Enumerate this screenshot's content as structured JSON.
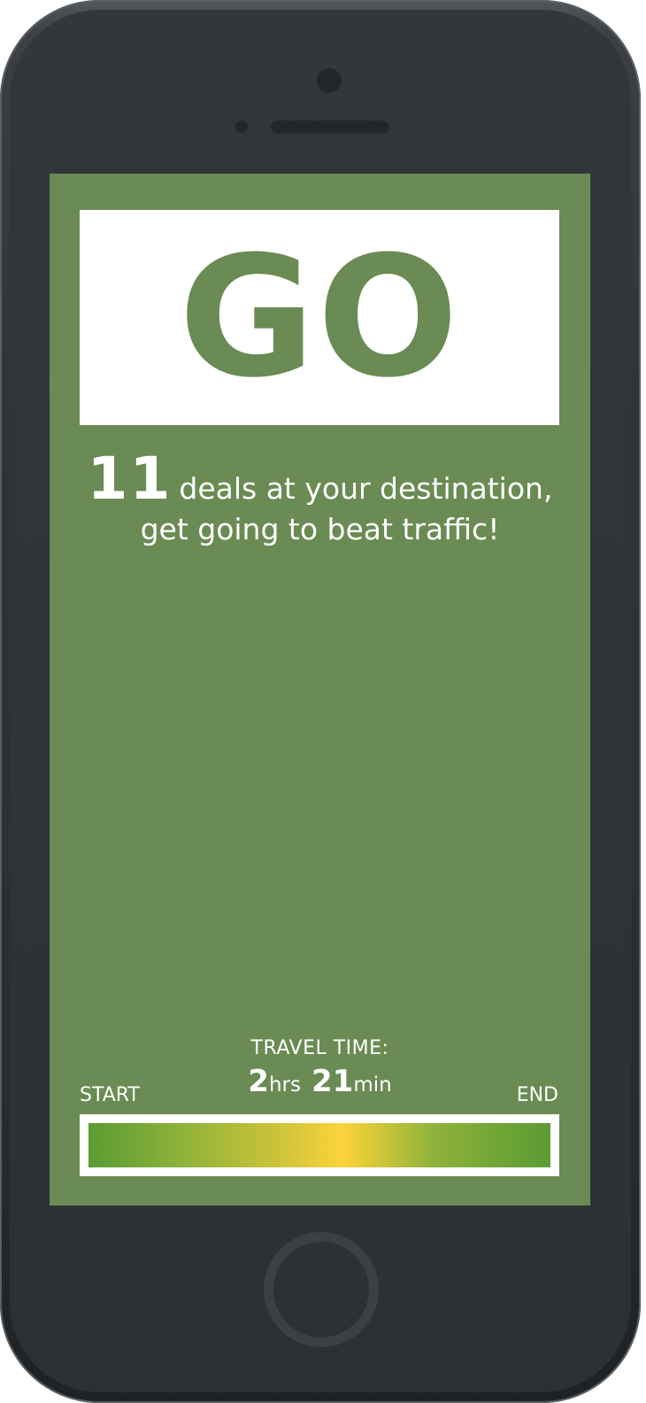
{
  "go_card": {
    "text": "GO"
  },
  "deals": {
    "count": "11",
    "text_line1": "deals at your destination,",
    "text_line2": "get going to beat traffic!"
  },
  "travel_time": {
    "label": "TRAVEL TIME:",
    "hours": "2",
    "hours_unit": "hrs",
    "minutes": "21",
    "minutes_unit": "min"
  },
  "route": {
    "start_label": "START",
    "end_label": "END",
    "traffic_colors": [
      "#5a9b33",
      "#8db23a",
      "#c9c23a",
      "#fbd43a",
      "#8db23a",
      "#5a9b33"
    ]
  },
  "colors": {
    "screen_background": "#6a8b53",
    "card_background": "#ffffff",
    "phone_body": "#2f3337"
  }
}
